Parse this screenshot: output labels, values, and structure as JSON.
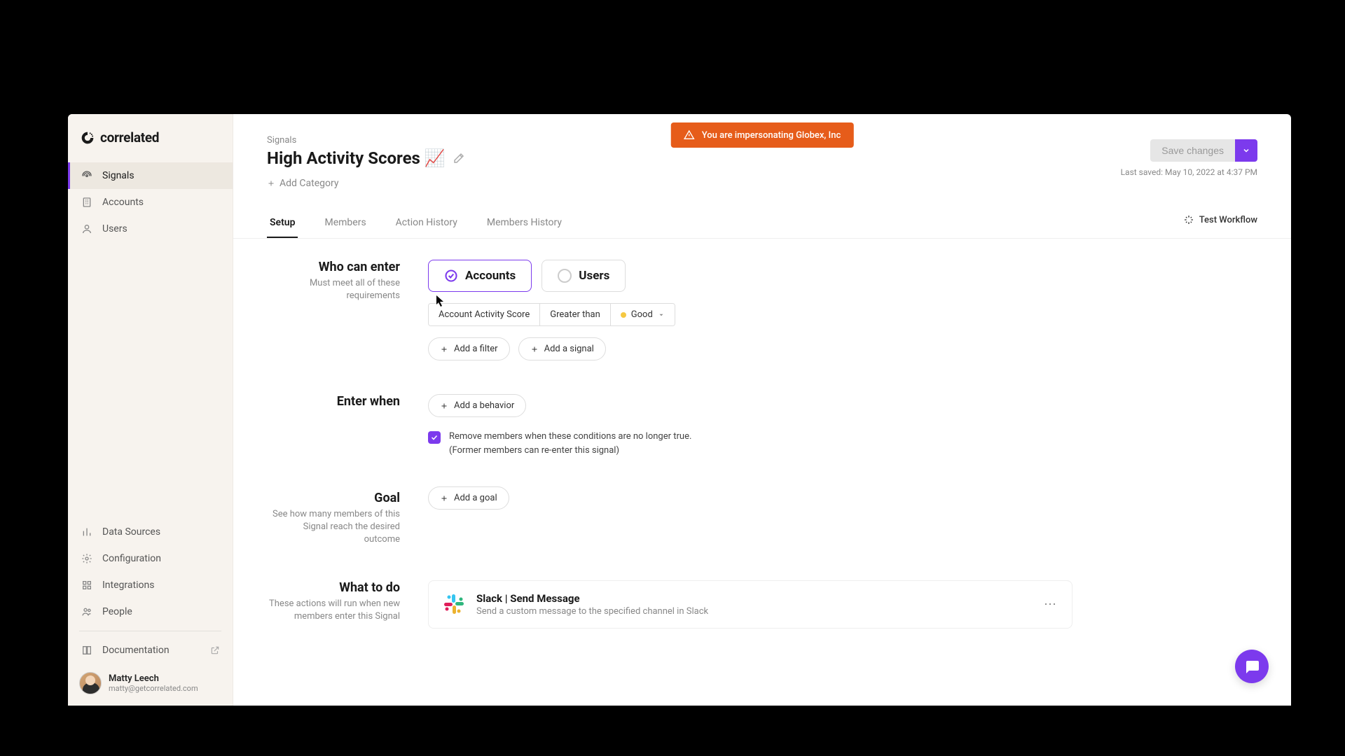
{
  "brand": "correlated",
  "sidebar": {
    "primary": [
      {
        "label": "Signals"
      },
      {
        "label": "Accounts"
      },
      {
        "label": "Users"
      }
    ],
    "secondary": [
      {
        "label": "Data Sources"
      },
      {
        "label": "Configuration"
      },
      {
        "label": "Integrations"
      },
      {
        "label": "People"
      },
      {
        "label": "Documentation"
      }
    ]
  },
  "user": {
    "name": "Matty Leech",
    "email": "matty@getcorrelated.com"
  },
  "impersonation": "You are impersonating Globex, Inc",
  "breadcrumb": "Signals",
  "page_title": "High Activity Scores 📈",
  "add_category": "Add Category",
  "save_button": "Save changes",
  "last_saved": "Last saved: May 10, 2022 at 4:37 PM",
  "tabs": [
    {
      "label": "Setup"
    },
    {
      "label": "Members"
    },
    {
      "label": "Action History"
    },
    {
      "label": "Members History"
    }
  ],
  "test_workflow": "Test Workflow",
  "sections": {
    "who": {
      "title": "Who can enter",
      "sub": "Must meet all of these requirements",
      "entity_accounts": "Accounts",
      "entity_users": "Users",
      "filter": {
        "field": "Account Activity Score",
        "operator": "Greater than",
        "value": "Good"
      },
      "add_filter": "Add a filter",
      "add_signal": "Add a signal"
    },
    "when": {
      "title": "Enter when",
      "add_behavior": "Add a behavior",
      "checkbox_line1": "Remove members when these conditions are no longer true.",
      "checkbox_line2": "(Former members can re-enter this signal)"
    },
    "goal": {
      "title": "Goal",
      "sub": "See how many members of this Signal reach the desired outcome",
      "add_goal": "Add a goal"
    },
    "what": {
      "title": "What to do",
      "sub": "These actions will run when new members enter this Signal",
      "action_title": "Slack | Send Message",
      "action_sub": "Send a custom message to the specified channel in Slack"
    }
  }
}
